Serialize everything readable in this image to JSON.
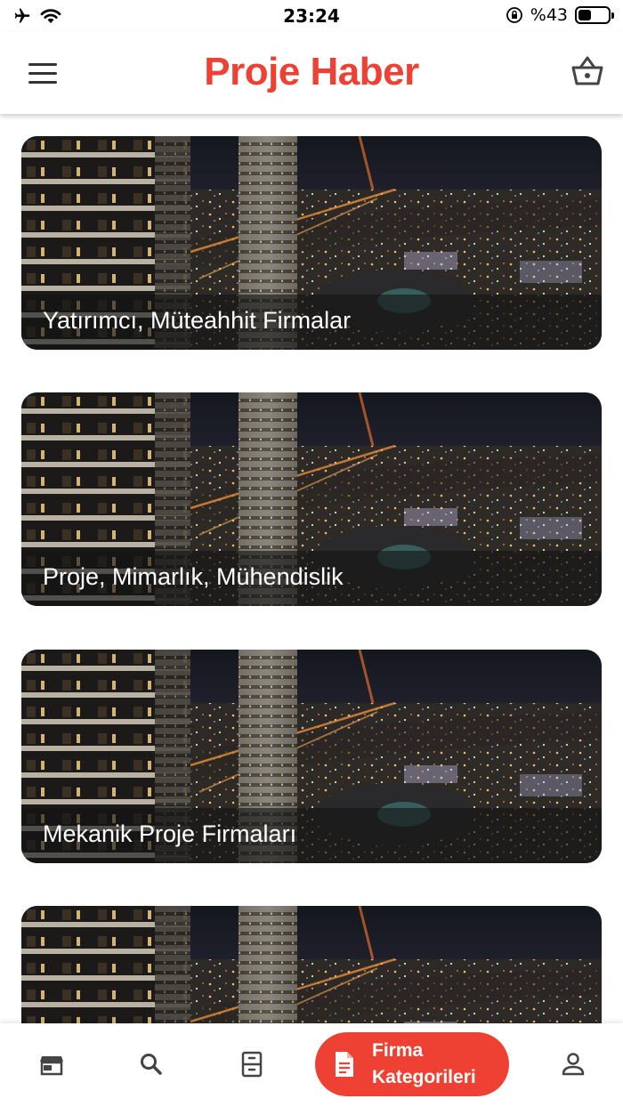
{
  "colors": {
    "brand": "#EE4033",
    "icon": "#444444"
  },
  "status_bar": {
    "time": "23:24",
    "battery_text": "%43",
    "battery_level": 0.43,
    "icons": [
      "airplane-icon",
      "wifi-icon",
      "orientation-lock-icon",
      "battery-icon"
    ]
  },
  "header": {
    "title": "Proje Haber",
    "menu_icon": "hamburger-menu-icon",
    "basket_icon": "shopping-basket-icon"
  },
  "categories": [
    {
      "label": "Yatırımcı, Müteahhit Firmalar"
    },
    {
      "label": "Proje, Mimarlık, Mühendislik"
    },
    {
      "label": "Mekanik Proje Firmaları"
    },
    {
      "label": ""
    }
  ],
  "bottom_nav": {
    "items": [
      {
        "icon": "storefront-icon"
      },
      {
        "icon": "search-icon"
      },
      {
        "icon": "filing-cabinet-icon"
      },
      {
        "icon": "document-icon",
        "line1": "Firma",
        "line2": "Kategorileri",
        "active": true
      },
      {
        "icon": "user-icon"
      }
    ]
  }
}
